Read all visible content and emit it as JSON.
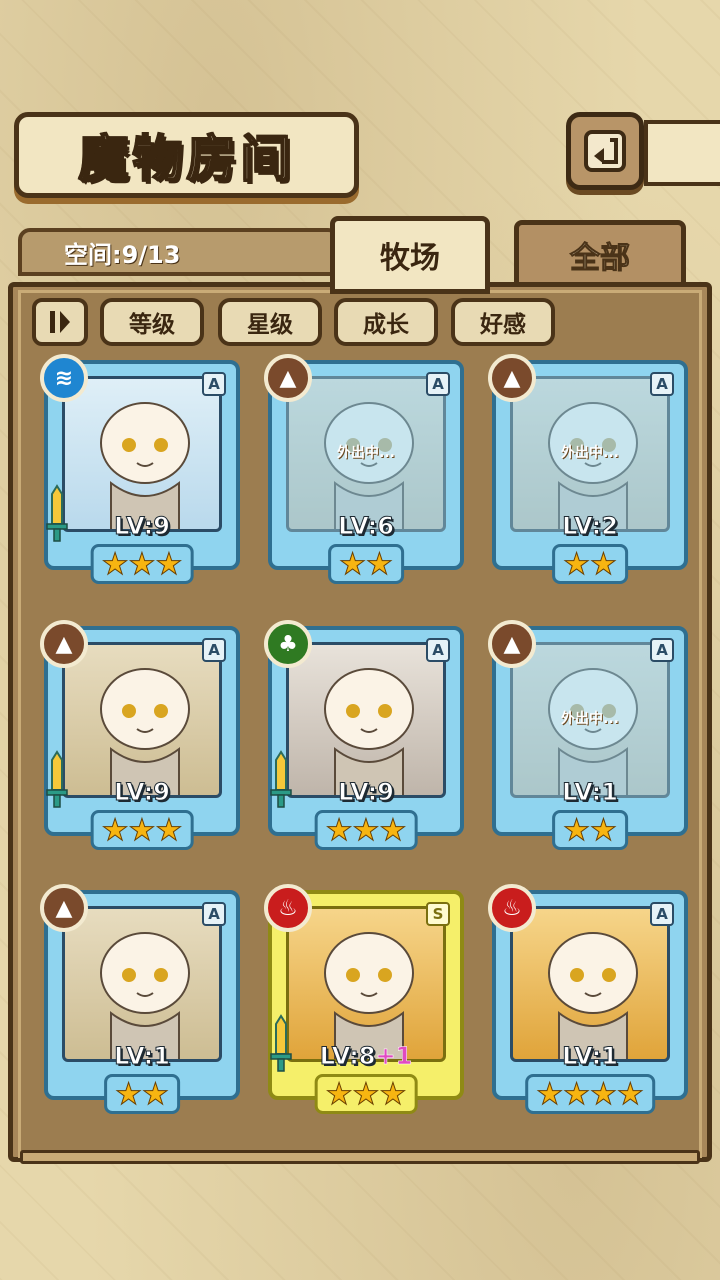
{
  "title": "魔物房间",
  "space": "空间:9/13",
  "tabs": [
    {
      "label": "牧场",
      "active": true
    },
    {
      "label": "全部",
      "active": false
    }
  ],
  "sort_toggle_icon": "sort-toggle-icon",
  "sort_buttons": [
    "等级",
    "星级",
    "成长",
    "好感"
  ],
  "colors": {
    "card_blue": "#8fd4ef",
    "card_gold": "#f5ef6a",
    "frame_brown": "#4a3318"
  },
  "cards": [
    {
      "element": "water",
      "rank": "A",
      "level": "LV:9",
      "stars": "★★★",
      "away": "",
      "sword": true
    },
    {
      "element": "earth",
      "rank": "A",
      "level": "LV:6",
      "stars": "★★",
      "away": "外出中...",
      "sword": false
    },
    {
      "element": "earth",
      "rank": "A",
      "level": "LV:2",
      "stars": "★★",
      "away": "外出中...",
      "sword": false
    },
    {
      "element": "earth",
      "rank": "A",
      "level": "LV:9",
      "stars": "★★★",
      "away": "",
      "sword": true
    },
    {
      "element": "wood",
      "rank": "A",
      "level": "LV:9",
      "stars": "★★★",
      "away": "",
      "sword": true
    },
    {
      "element": "earth",
      "rank": "A",
      "level": "LV:1",
      "stars": "★★",
      "away": "外出中...",
      "sword": false
    },
    {
      "element": "earth",
      "rank": "A",
      "level": "LV:1",
      "stars": "★★",
      "away": "",
      "sword": false
    },
    {
      "element": "fire",
      "rank": "S",
      "level": "LV:8",
      "level_bonus": "+1",
      "stars": "★★★",
      "away": "",
      "sword": true
    },
    {
      "element": "fire",
      "rank": "A",
      "level": "LV:1",
      "stars": "★★★★",
      "away": "",
      "sword": false
    }
  ]
}
